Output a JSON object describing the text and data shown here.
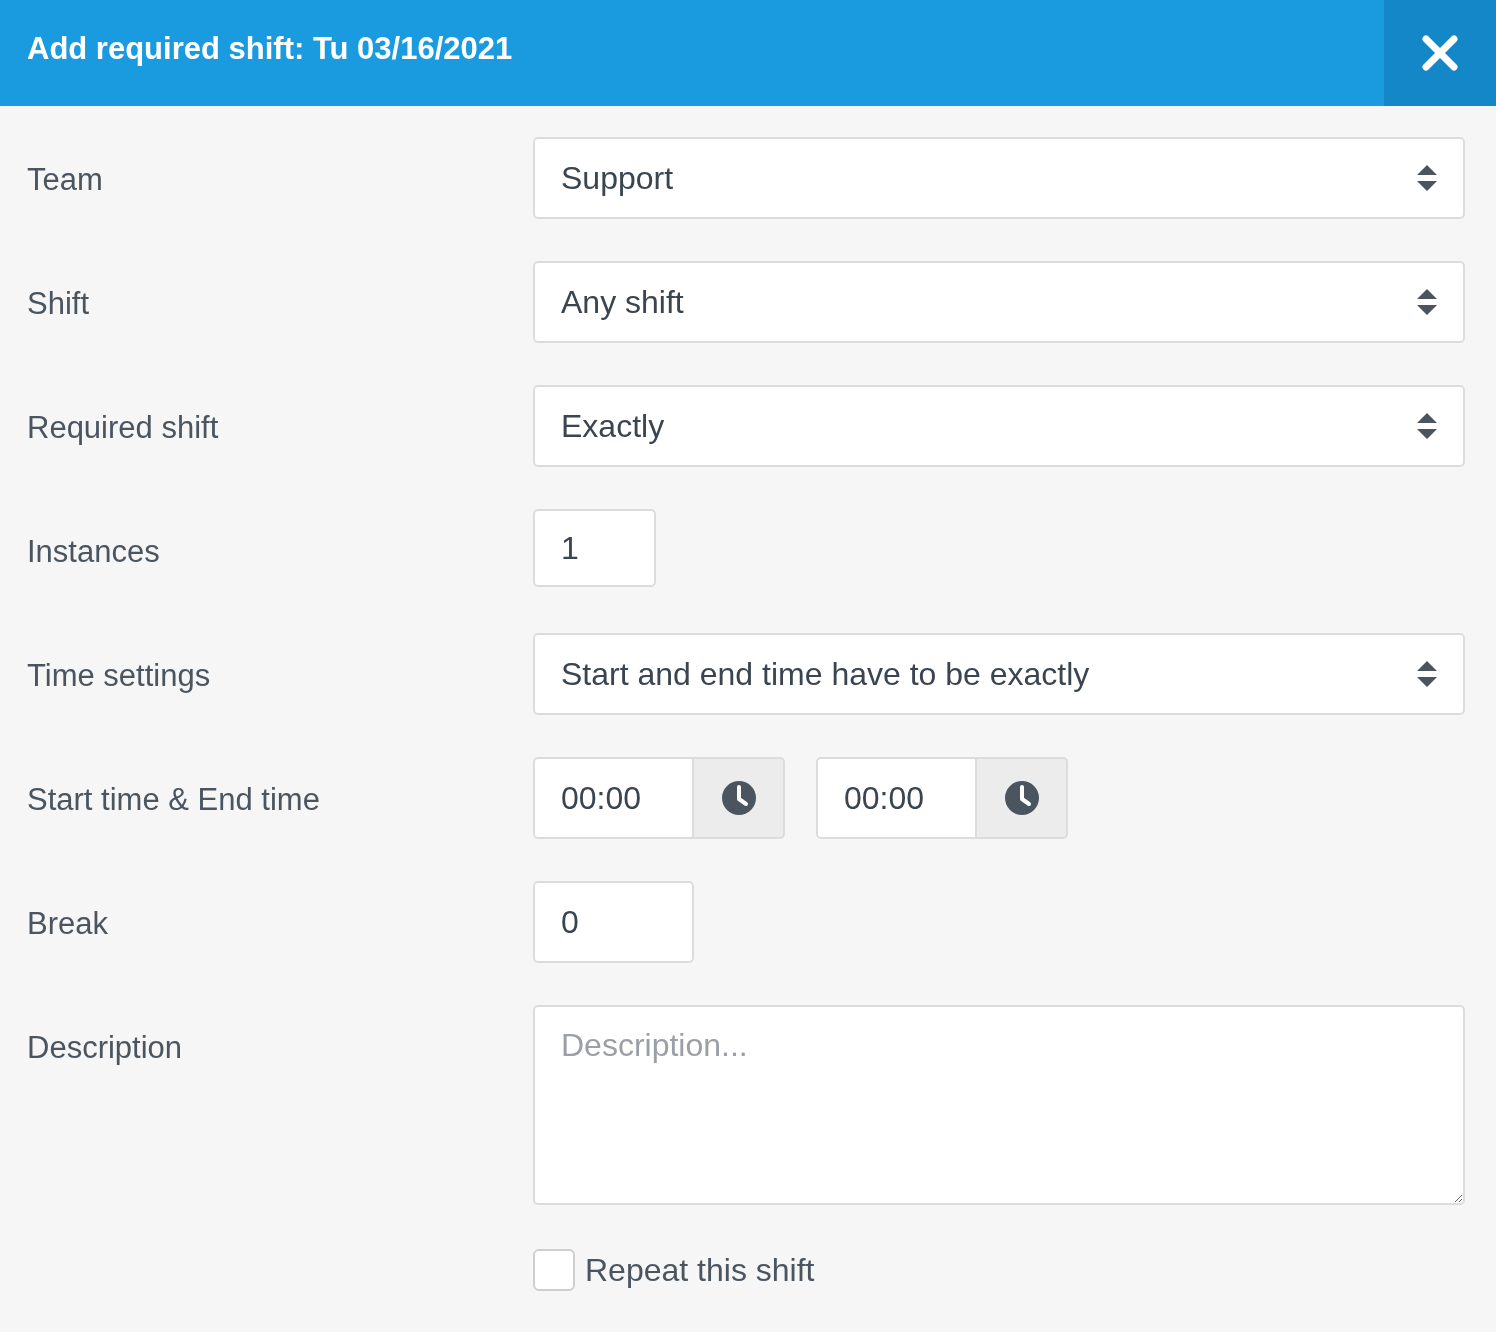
{
  "dialog": {
    "title": "Add required shift: Tu 03/16/2021"
  },
  "fields": [
    {
      "kind": "select",
      "label": "Team",
      "value": "Support"
    },
    {
      "kind": "select",
      "label": "Shift",
      "value": "Any shift"
    },
    {
      "kind": "select",
      "label": "Required shift",
      "value": "Exactly"
    },
    {
      "kind": "small",
      "label": "Instances",
      "value": "1"
    },
    {
      "kind": "select",
      "label": "Time settings",
      "value": "Start and end time have to be exactly"
    },
    {
      "kind": "time_range",
      "label": "Start time & End time",
      "start": "00:00",
      "end": "00:00"
    },
    {
      "kind": "number",
      "label": "Break",
      "value": "0"
    },
    {
      "kind": "textarea",
      "label": "Description",
      "placeholder": "Description..."
    }
  ],
  "repeat": {
    "label": "Repeat this shift",
    "checked": false
  }
}
